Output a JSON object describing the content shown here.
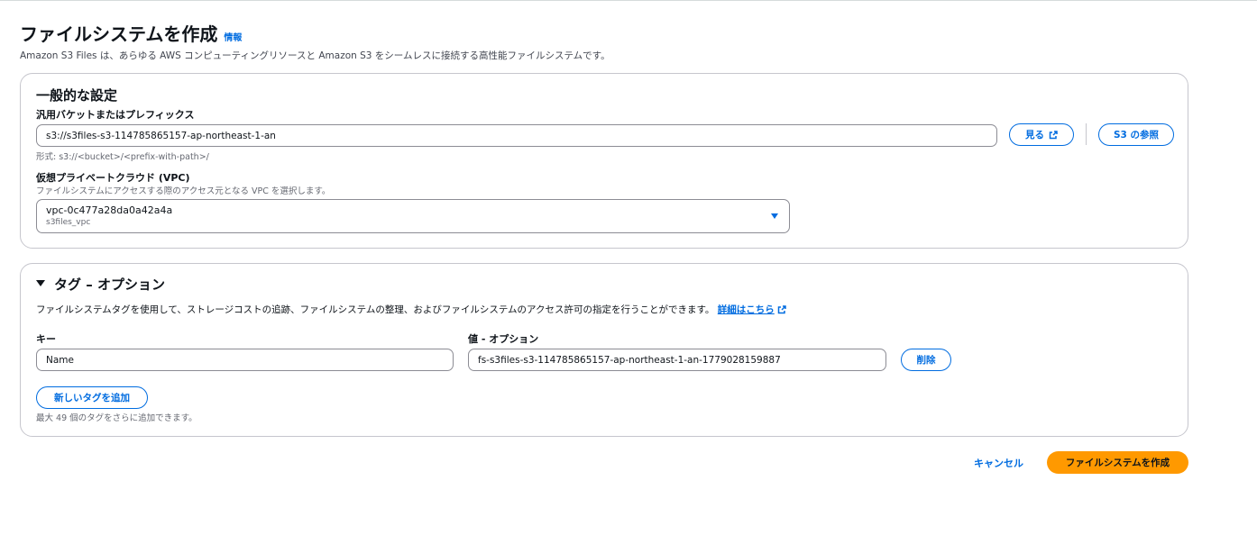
{
  "header": {
    "title": "ファイルシステムを作成",
    "info_link": "情報",
    "subtitle": "Amazon S3 Files は、あらゆる AWS コンピューティングリソースと Amazon S3 をシームレスに接続する高性能ファイルシステムです。"
  },
  "general": {
    "heading": "一般的な設定",
    "bucket_label": "汎用バケットまたはプレフィックス",
    "bucket_value": "s3://s3files-s3-114785865157-ap-northeast-1-an",
    "bucket_hint": "形式: s3://<bucket>/<prefix-with-path>/",
    "view_button": "見る",
    "browse_button": "S3 の参照",
    "vpc_label": "仮想プライベートクラウド (VPC)",
    "vpc_desc": "ファイルシステムにアクセスする際のアクセス元となる VPC を選択します。",
    "vpc_value": "vpc-0c477a28da0a42a4a",
    "vpc_name": "s3files_vpc"
  },
  "tags": {
    "heading": "タグ – オプション",
    "description": "ファイルシステムタグを使用して、ストレージコストの追跡、ファイルシステムの整理、およびファイルシステムのアクセス許可の指定を行うことができます。",
    "learn_more": "詳細はこちら",
    "key_label": "キー",
    "value_label": "値 - オプション",
    "key_value": "Name",
    "value_value": "fs-s3files-s3-114785865157-ap-northeast-1-an-1779028159887",
    "remove_button": "削除",
    "add_button": "新しいタグを追加",
    "limit_hint": "最大 49 個のタグをさらに追加できます。"
  },
  "footer": {
    "cancel": "キャンセル",
    "create": "ファイルシステムを作成"
  },
  "colors": {
    "link": "#006ce0",
    "primary": "#ff9900",
    "border": "#c6c6cd"
  },
  "icons": {
    "external": "external-link-icon",
    "caret_select": "caret-down-icon",
    "caret_toggle": "caret-down-icon"
  }
}
